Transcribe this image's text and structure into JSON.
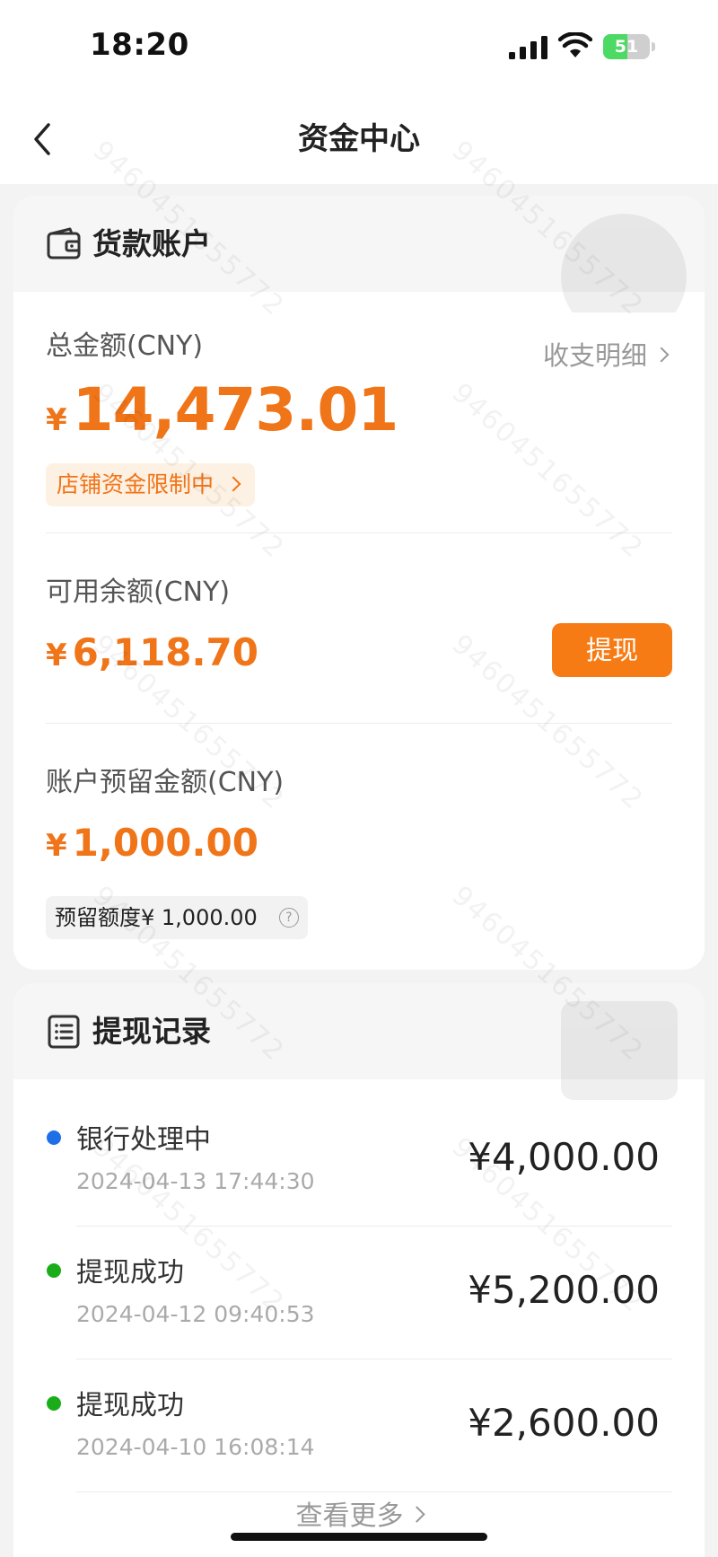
{
  "status_bar": {
    "time": "18:20",
    "battery_level": "51",
    "battery_fraction": 0.51,
    "icons": [
      "signal-icon",
      "wifi-icon",
      "battery-icon"
    ]
  },
  "nav": {
    "title": "资金中心",
    "back_icon": "chevron-left-icon"
  },
  "account": {
    "header_title": "货款账户",
    "header_icon": "wallet-icon",
    "total_label": "总金额(CNY)",
    "detail_link": "收支明细",
    "currency_symbol": "¥",
    "total_amount": "14,473.01",
    "restrict_tag": "店铺资金限制中",
    "available_label": "可用余额(CNY)",
    "available_amount": "6,118.70",
    "withdraw_button": "提现",
    "reserve_label": "账户预留金额(CNY)",
    "reserve_amount": "1,000.00",
    "reserve_quota": "预留额度¥ 1,000.00",
    "help_glyph": "?"
  },
  "records": {
    "header_title": "提现记录",
    "header_icon": "list-icon",
    "items": [
      {
        "status": "银行处理中",
        "time": "2024-04-13 17:44:30",
        "amount": "¥4,000.00",
        "dot_color": "#1e6fe8"
      },
      {
        "status": "提现成功",
        "time": "2024-04-12 09:40:53",
        "amount": "¥5,200.00",
        "dot_color": "#1aad19"
      },
      {
        "status": "提现成功",
        "time": "2024-04-10 16:08:14",
        "amount": "¥2,600.00",
        "dot_color": "#1aad19"
      }
    ],
    "more_link": "查看更多"
  },
  "watermark_text": "9460451655772",
  "colors": {
    "accent": "#f07418",
    "button": "#f77b14",
    "processing": "#1e6fe8",
    "success": "#1aad19"
  }
}
